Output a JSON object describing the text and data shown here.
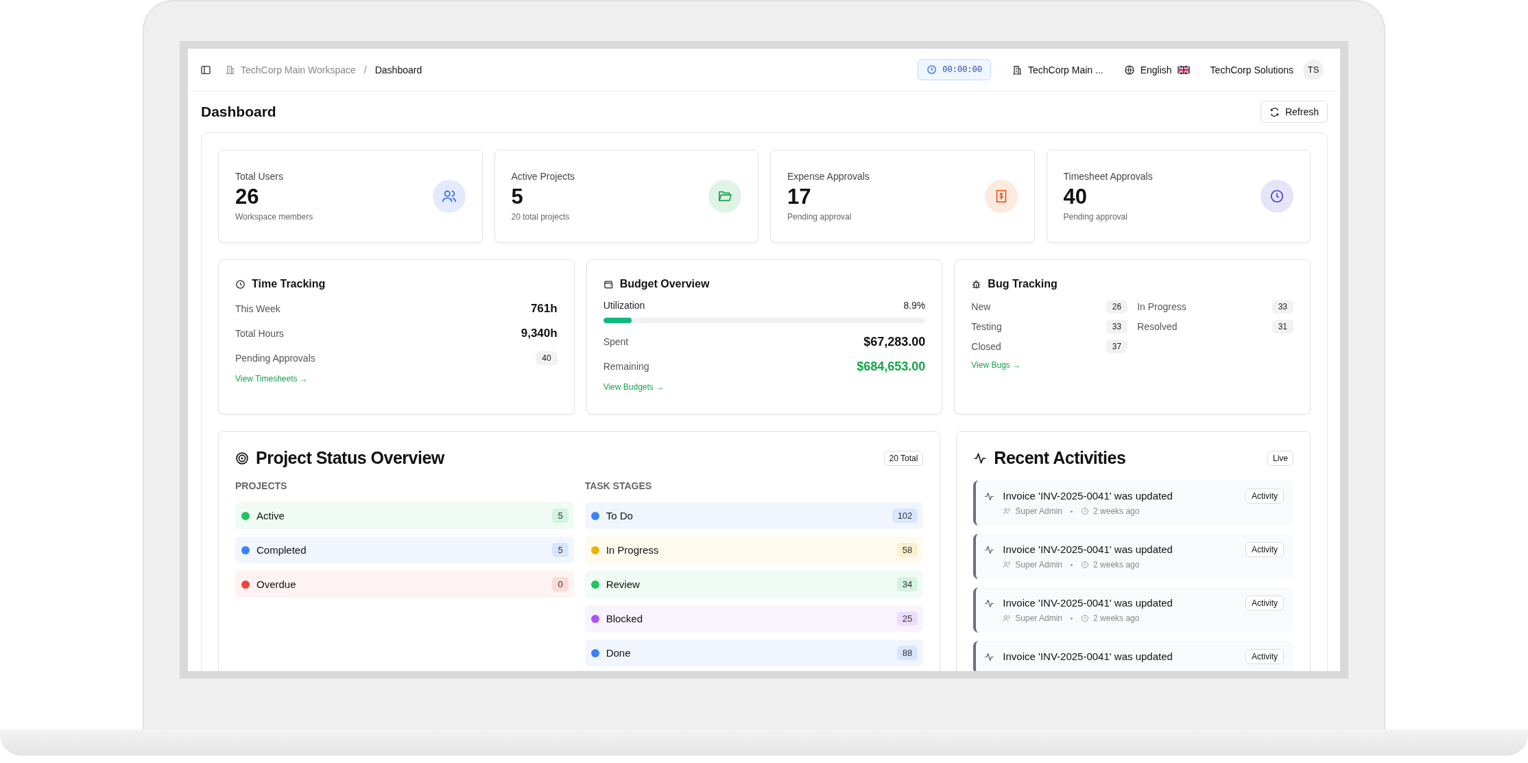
{
  "header": {
    "breadcrumb": [
      {
        "label": "TechCorp Main Workspace",
        "kind": "workspace"
      },
      {
        "label": "Dashboard",
        "kind": "page"
      }
    ],
    "breadcrumb_separator": "/",
    "timer": "00:00:00",
    "workspace": "TechCorp Main ...",
    "language": "English",
    "user": "TechCorp Solutions",
    "avatar": "TS"
  },
  "page": {
    "title": "Dashboard",
    "refresh_button": "Refresh"
  },
  "stats": [
    {
      "label": "Total Users",
      "value": "26",
      "caption": "Workspace members",
      "kind": "users",
      "color": "#2563eb"
    },
    {
      "label": "Active Projects",
      "value": "5",
      "caption": "20 total projects",
      "kind": "folder",
      "color": "#16a34a"
    },
    {
      "label": "Expense Approvals",
      "value": "17",
      "caption": "Pending approval",
      "kind": "receipt",
      "color": "#ea580c"
    },
    {
      "label": "Timesheet Approvals",
      "value": "40",
      "caption": "Pending approval",
      "kind": "clock",
      "color": "#4338ca"
    }
  ],
  "time_tracking": {
    "title": "Time Tracking",
    "rows": [
      {
        "label": "This Week",
        "value": "761h",
        "kind": "text"
      },
      {
        "label": "Total Hours",
        "value": "9,340h",
        "kind": "text"
      },
      {
        "label": "Pending Approvals",
        "value": "40",
        "kind": "badge"
      }
    ],
    "link": "View Timesheets →"
  },
  "budget": {
    "title": "Budget Overview",
    "utilization_label": "Utilization",
    "utilization_value": "8.9%",
    "level": 0.089,
    "rows": [
      {
        "label": "Spent",
        "value": "$67,283.00",
        "kind": "neutral"
      },
      {
        "label": "Remaining",
        "value": "$684,653.00",
        "kind": "positive"
      }
    ],
    "link": "View Budgets →"
  },
  "bugs": {
    "title": "Bug Tracking",
    "items": [
      {
        "label": "New",
        "count": "26"
      },
      {
        "label": "In Progress",
        "count": "33"
      },
      {
        "label": "Testing",
        "count": "33"
      },
      {
        "label": "Resolved",
        "count": "31"
      },
      {
        "label": "Closed",
        "count": "37"
      }
    ],
    "link": "View Bugs →"
  },
  "project_status": {
    "title": "Project Status Overview",
    "total_badge": "20 Total",
    "projects": {
      "heading": "PROJECTS",
      "items": [
        {
          "label": "Active",
          "count": "5",
          "color": "#22c55e"
        },
        {
          "label": "Completed",
          "count": "5",
          "color": "#3b82f6"
        },
        {
          "label": "Overdue",
          "count": "0",
          "color": "#ef4444"
        }
      ]
    },
    "task_stages": {
      "heading": "TASK STAGES",
      "items": [
        {
          "label": "To Do",
          "count": "102",
          "color": "#3b82f6"
        },
        {
          "label": "In Progress",
          "count": "58",
          "color": "#eab308"
        },
        {
          "label": "Review",
          "count": "34",
          "color": "#22c55e"
        },
        {
          "label": "Blocked",
          "count": "25",
          "color": "#a855f7"
        },
        {
          "label": "Done",
          "count": "88",
          "color": "#3b82f6"
        }
      ]
    }
  },
  "activities": {
    "title": "Recent Activities",
    "badge": "Live",
    "items": [
      {
        "text": "Invoice 'INV-2025-0041' was updated",
        "user": "Super Admin",
        "time": "2 weeks ago",
        "tag": "Activity"
      },
      {
        "text": "Invoice 'INV-2025-0041' was updated",
        "user": "Super Admin",
        "time": "2 weeks ago",
        "tag": "Activity"
      },
      {
        "text": "Invoice 'INV-2025-0041' was updated",
        "user": "Super Admin",
        "time": "2 weeks ago",
        "tag": "Activity"
      },
      {
        "text": "Invoice 'INV-2025-0041' was updated",
        "tag": "Activity"
      }
    ]
  }
}
